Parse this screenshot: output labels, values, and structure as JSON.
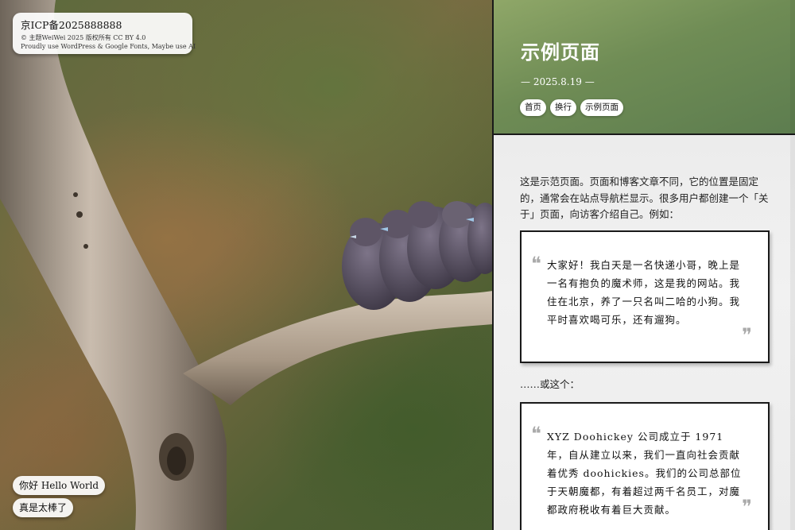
{
  "footer_badge": {
    "icp": "京ICP备2025888888",
    "copyright": "© 主题WeiWei 2025 版权所有 CC BY 4.0",
    "credits": "Proudly use WordPress & Google Fonts, Maybe use AI"
  },
  "greetings": {
    "hello": "你好 Hello World",
    "great": "真是太棒了"
  },
  "page": {
    "title": "示例页面",
    "date": "— 2025.8.19 —",
    "breadcrumbs": [
      "首页",
      "换行",
      "示例页面"
    ]
  },
  "content": {
    "intro": "这是示范页面。页面和博客文章不同，它的位置是固定的，通常会在站点导航栏显示。很多用户都创建一个「关于」页面，向访客介绍自己。例如：",
    "quote1": "大家好！我白天是一名快递小哥，晚上是一名有抱负的魔术师，这是我的网站。我住在北京，养了一只名叫二哈的小狗。我平时喜欢喝可乐，还有遛狗。",
    "or_this": "……或这个：",
    "quote2": "XYZ Doohickey 公司成立于 1971 年，自从建立以来，我们一直向社会贡献着优秀 doohickies。我们的公司总部位于天朝魔都，有着超过两千名员工，对魔都政府税收有着巨大贡献。"
  },
  "icons": {
    "open_quote": "quote-open-icon",
    "close_quote": "quote-close-icon"
  }
}
